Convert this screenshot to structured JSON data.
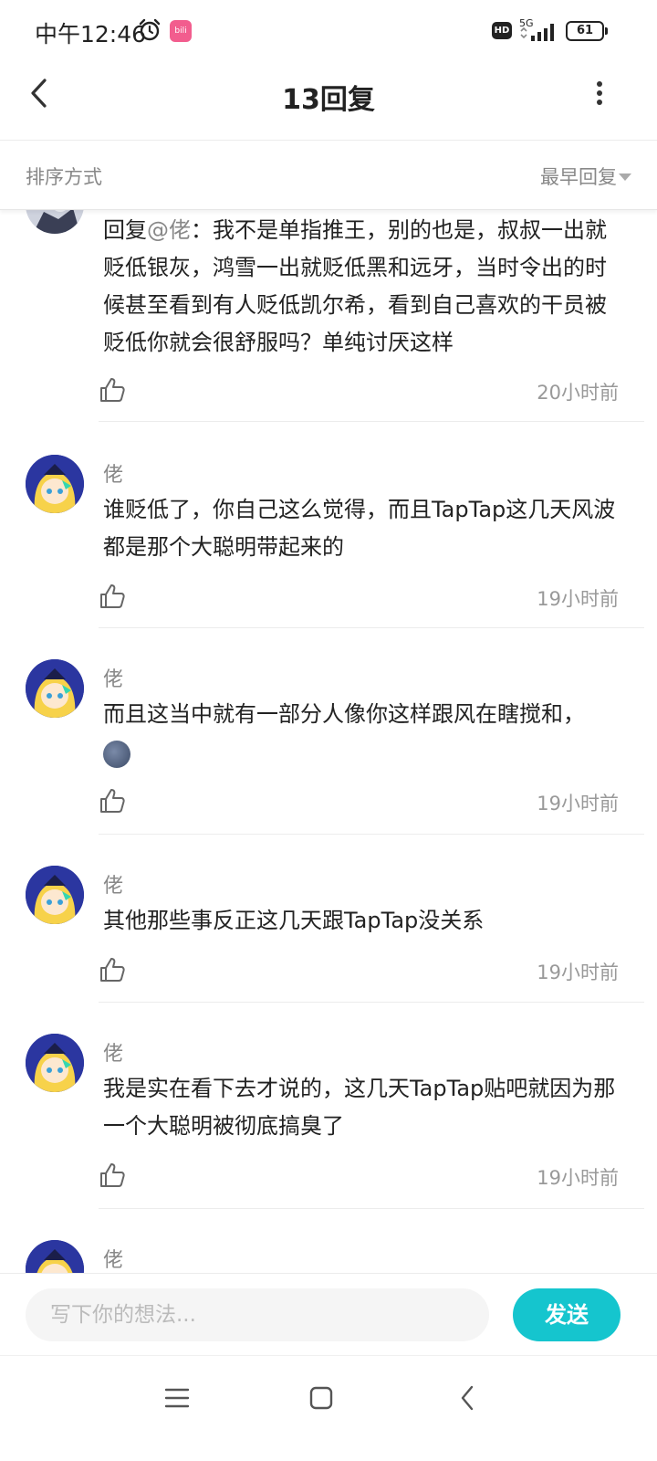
{
  "status_bar": {
    "time": "中午12:46",
    "app_badge": "bili",
    "hd": "HD",
    "network": "5G",
    "battery": "61"
  },
  "header": {
    "title": "13回复"
  },
  "sort": {
    "label": "排序方式",
    "selected": "最早回复"
  },
  "replies": [
    {
      "author": "",
      "mention_prefix": "回复",
      "mention": "@佬",
      "text": "：我不是单指推王，别的也是，叔叔一出就贬低银灰，鸿雪一出就贬低黑和远牙，当时令出的时候甚至看到有人贬低凯尔希，看到自己喜欢的干员被贬低你就会很舒服吗？单纯讨厌这样",
      "time": "20小时前"
    },
    {
      "author": "佬",
      "text": "谁贬低了，你自己这么觉得，而且TapTap这几天风波都是那个大聪明带起来的",
      "time": "19小时前"
    },
    {
      "author": "佬",
      "text": "而且这当中就有一部分人像你这样跟风在瞎搅和，",
      "emoji": "new-moon-face",
      "time": "19小时前"
    },
    {
      "author": "佬",
      "text": "其他那些事反正这几天跟TapTap没关系",
      "time": "19小时前"
    },
    {
      "author": "佬",
      "text": "我是实在看下去才说的，这几天TapTap贴吧就因为那一个大聪明被彻底搞臭了",
      "time": "19小时前"
    },
    {
      "author": "佬"
    }
  ],
  "composer": {
    "placeholder": "写下你的想法...",
    "send_label": "发送"
  },
  "colors": {
    "accent": "#15c5ce",
    "muted": "#888888",
    "text": "#222222"
  }
}
